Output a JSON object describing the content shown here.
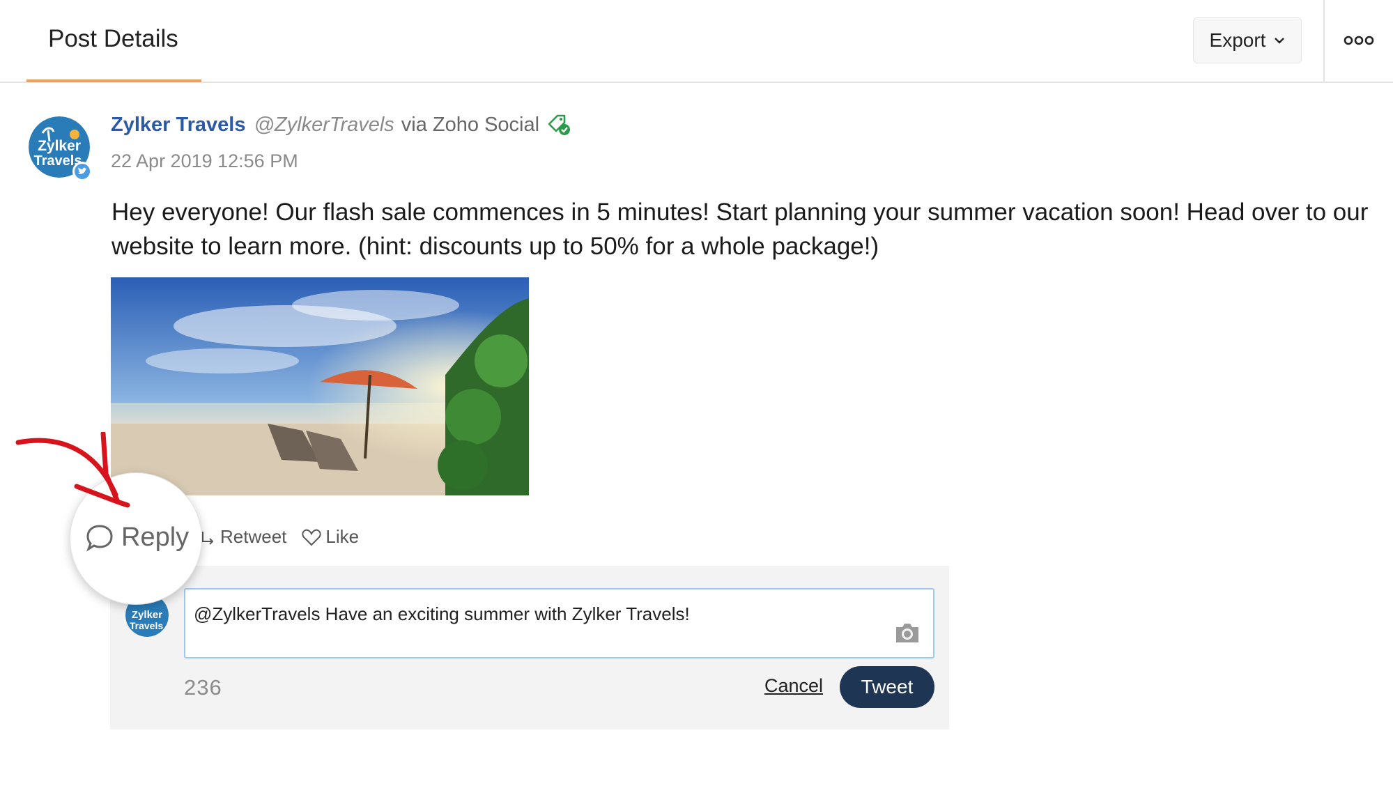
{
  "header": {
    "title": "Post Details",
    "export_label": "Export",
    "accent_color": "#e8a25a"
  },
  "post": {
    "author_name": "Zylker Travels",
    "author_handle": "@ZylkerTravels",
    "via_text": "via Zoho Social",
    "timestamp": "22 Apr 2019 12:56 PM",
    "text": "Hey everyone! Our flash sale commences in 5 minutes! Start planning your summer vacation soon! Head over to our website to learn more. (hint: discounts up to 50% for a whole package!)",
    "avatar_text_line1": "Zylker",
    "avatar_text_line2": "Travels",
    "image_semantic": "beach-umbrella-photo"
  },
  "actions": {
    "reply_label": "Reply",
    "retweet_label": "Retweet",
    "like_label": "Like"
  },
  "reply_box": {
    "value": "@ZylkerTravels Have an exciting summer with Zylker Travels!",
    "char_count": "236",
    "cancel_label": "Cancel",
    "tweet_label": "Tweet",
    "tweet_color": "#1f3554"
  },
  "colors": {
    "author": "#2a5aa6",
    "annotation_arrow": "#d7141c"
  }
}
